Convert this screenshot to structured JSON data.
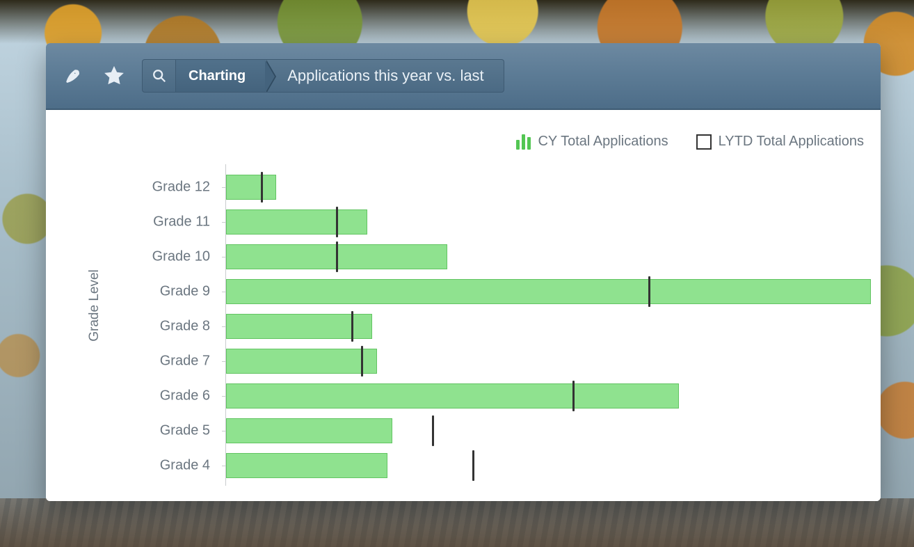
{
  "header": {
    "breadcrumb_primary": "Charting",
    "breadcrumb_secondary": "Applications this year vs. last"
  },
  "legend": {
    "cy": "CY Total Applications",
    "lytd": "LYTD Total Applications"
  },
  "axis": {
    "y_title": "Grade Level"
  },
  "colors": {
    "bar_fill": "#8fe28f",
    "bar_stroke": "#62c462",
    "marker": "#333333",
    "header_bg": "#5d7c96"
  },
  "chart_data": {
    "type": "bar",
    "orientation": "horizontal",
    "title": "Applications this year vs. last",
    "xlabel": "",
    "ylabel": "Grade Level",
    "xlim": [
      0,
      130
    ],
    "categories": [
      "Grade 12",
      "Grade 11",
      "Grade 10",
      "Grade 9",
      "Grade 8",
      "Grade 7",
      "Grade 6",
      "Grade 5",
      "Grade 4"
    ],
    "series": [
      {
        "name": "CY Total Applications",
        "values": [
          10,
          28,
          44,
          128,
          29,
          30,
          90,
          33,
          32
        ]
      },
      {
        "name": "LYTD Total Applications",
        "values": [
          7,
          22,
          22,
          84,
          25,
          27,
          69,
          41,
          49
        ]
      }
    ]
  }
}
